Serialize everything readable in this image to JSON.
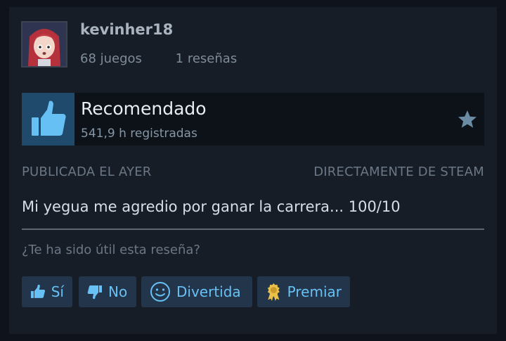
{
  "user": {
    "username": "kevinher18",
    "games": "68 juegos",
    "reviews": "1 reseñas"
  },
  "review": {
    "verdict": "Recomendado",
    "hours": "541,9 h registradas",
    "posted": "PUBLICADA EL AYER",
    "source": "DIRECTAMENTE DE STEAM",
    "text": "Mi yegua me agredio por ganar la carrera... 100/10"
  },
  "feedback": {
    "question": "¿Te ha sido útil esta reseña?",
    "yes": "Sí",
    "no": "No",
    "funny": "Divertida",
    "award": "Premiar"
  },
  "colors": {
    "background": "#0f141c",
    "card": "#161d27",
    "thumb_box": "#1f4a6b",
    "button": "#23354a",
    "link_blue": "#67c1f5",
    "award_gold": "#e8c04a"
  },
  "icons": {
    "thumb": "thumbs-up-icon",
    "star": "star-icon",
    "no": "thumbs-down-icon",
    "funny": "smiley-icon",
    "award": "award-icon"
  }
}
